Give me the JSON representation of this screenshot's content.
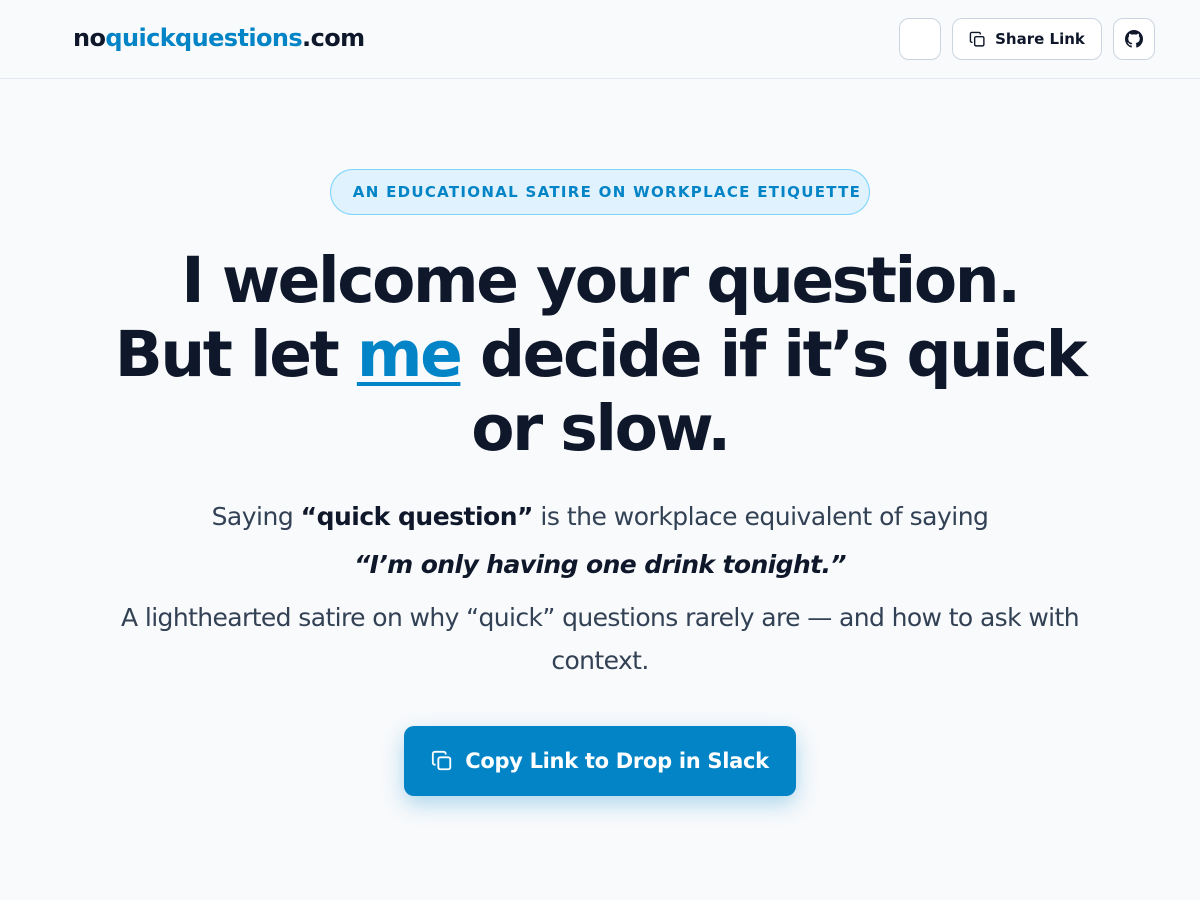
{
  "header": {
    "logo": {
      "prefix": "no",
      "middle": "quickquestions",
      "suffix": ".com"
    },
    "share_label": "Share Link"
  },
  "hero": {
    "badge": "AN EDUCATIONAL SATIRE ON WORKPLACE ETIQUETTE",
    "headline": {
      "line1": "I welcome your question.",
      "line2_pre": "But let ",
      "line2_emph": "me",
      "line2_post": " decide if it’s quick or slow."
    },
    "subtitle": {
      "pre": "Saying ",
      "bold": "“quick question”",
      "post": " is the workplace equivalent of saying"
    },
    "quote": "“I’m only having one drink tonight.”",
    "description": "A lighthearted satire on why “quick” questions rarely are — and how to ask with context.",
    "cta_label": "Copy Link to Drop in Slack"
  },
  "icons": {
    "share": "copy-icon",
    "github": "github-icon",
    "cta": "copy-icon"
  },
  "colors": {
    "accent": "#0284c7",
    "text": "#0f172a",
    "muted": "#334155",
    "background": "#f8fafc",
    "badge_bg": "#e0f2fe"
  }
}
